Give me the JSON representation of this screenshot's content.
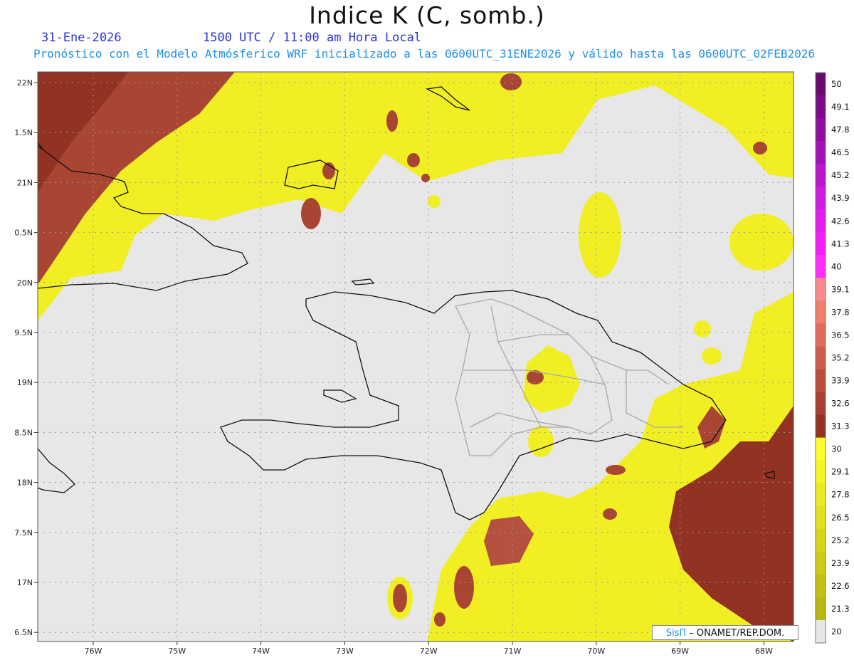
{
  "title": "Indice K (C, somb.)",
  "date": "31-Ene-2026",
  "time_line": "1500 UTC / 11:00 am Hora Local",
  "forecast_line": "Pronóstico con el Modelo Atmósferico WRF inicializado a las 0600UTC_31ENE2026 y válido hasta las  0600UTC_02FEB2026",
  "lat_labels": [
    "22N",
    "1.5N",
    "21N",
    "0.5N",
    "20N",
    "9.5N",
    "19N",
    "8.5N",
    "18N",
    "7.5N",
    "17N",
    "6.5N"
  ],
  "lon_labels": [
    "76W",
    "75W",
    "74W",
    "73W",
    "72W",
    "71W",
    "70W",
    "69W",
    "68W"
  ],
  "colorbar": {
    "labels": [
      "50",
      "49.1",
      "47.8",
      "46.5",
      "45.2",
      "43.9",
      "42.6",
      "41.3",
      "40",
      "39.1",
      "37.8",
      "36.5",
      "35.2",
      "33.9",
      "32.6",
      "31.3",
      "30",
      "29.1",
      "27.8",
      "26.5",
      "25.2",
      "23.9",
      "22.6",
      "21.3",
      "20"
    ],
    "colors": [
      "#6a0a6e",
      "#7c0c86",
      "#8f0f9e",
      "#a312b6",
      "#b916cd",
      "#cf1adf",
      "#e21ced",
      "#f41df8",
      "#ff2fff",
      "#fa8a8a",
      "#f07f6a",
      "#e06d5c",
      "#cf5d4c",
      "#bc4d3e",
      "#a74030",
      "#913222",
      "#fffc2c",
      "#f7f422",
      "#eceb1f",
      "#e1e01c",
      "#d7d519",
      "#cdcb16",
      "#c3c013",
      "#b9b610",
      "#e7e7e7"
    ]
  },
  "credit": {
    "brand": "SisΠ",
    "text": " – ONAMET/REP.DOM."
  }
}
